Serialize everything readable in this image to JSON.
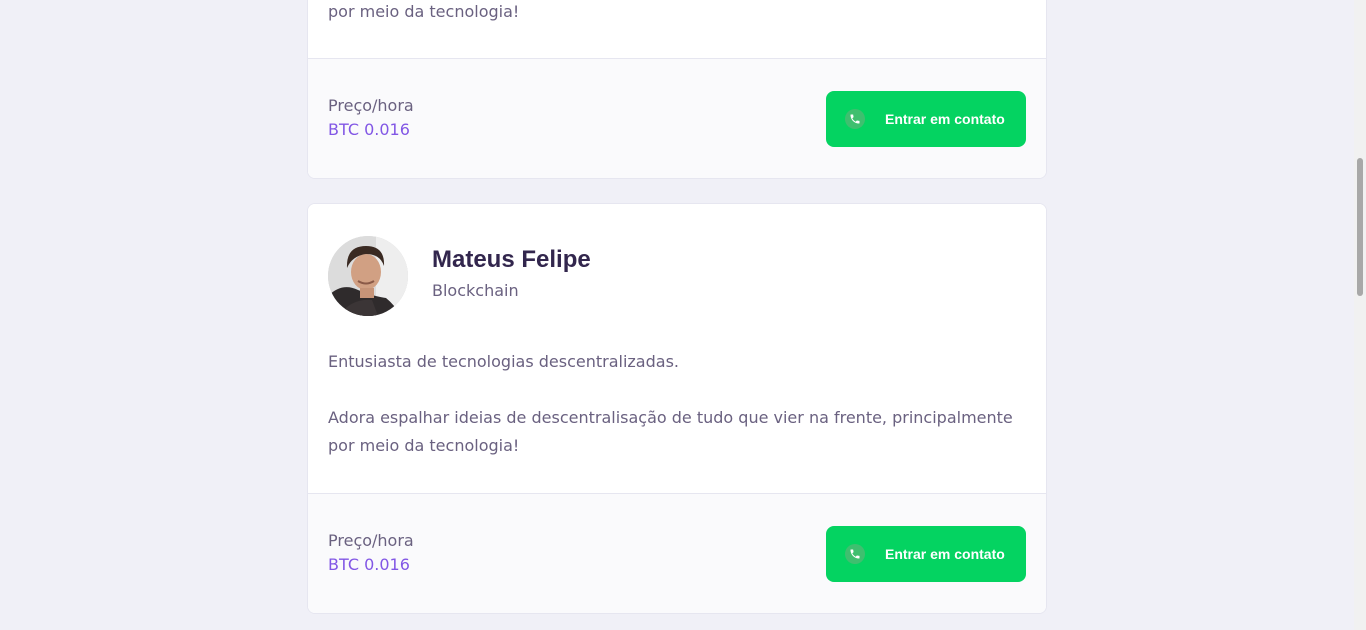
{
  "cards": [
    {
      "description_lines": [
        "por meio da tecnologia!"
      ],
      "price_label": "Preço/hora",
      "price_value": "BTC 0.016",
      "button_label": "Entrar em contato"
    },
    {
      "name": "Mateus Felipe",
      "subject": "Blockchain",
      "description_lines": [
        "Entusiasta de tecnologias descentralizadas.",
        "Adora espalhar ideias de descentralisação de tudo que vier na frente, principalmente",
        "por meio da tecnologia!"
      ],
      "price_label": "Preço/hora",
      "price_value": "BTC 0.016",
      "button_label": "Entrar em contato"
    }
  ],
  "icons": {
    "contact": "whatsapp-icon",
    "avatar": "person-photo"
  },
  "colors": {
    "background": "#f0f0f7",
    "name": "#32264d",
    "text": "#6a6180",
    "price": "#8257e5",
    "button": "#04d361"
  }
}
